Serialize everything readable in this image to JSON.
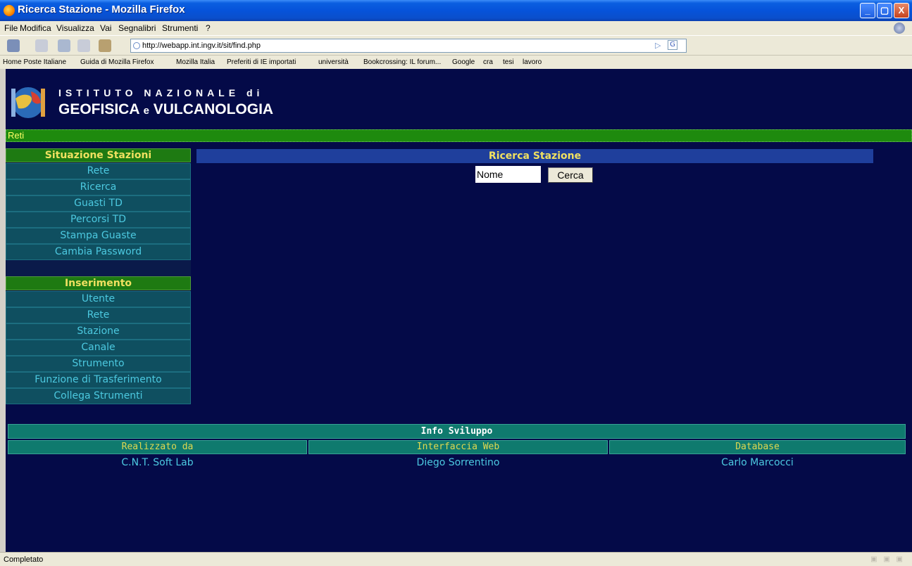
{
  "window": {
    "title": "Ricerca Stazione - Mozilla Firefox",
    "minimize": "_",
    "maximize": "▢",
    "close": "X"
  },
  "menubar": [
    "File",
    "Modifica",
    "Visualizza",
    "Vai",
    "Segnalibri",
    "Strumenti",
    "?"
  ],
  "navbar": {
    "url": "http://webapp.int.ingv.it/sit/find.php",
    "go_label": "▷",
    "search_engine_label": "G"
  },
  "bookmarks": [
    "Home Poste Italiane",
    "Guida di Mozilla Firefox",
    "Mozilla Italia",
    "Preferiti di IE importati",
    "università",
    "Bookcrossing: IL forum...",
    "Google",
    "cra",
    "tesi",
    "lavoro"
  ],
  "logo": {
    "line1": "ISTITUTO NAZIONALE di",
    "line2_a": "GEOFISICA ",
    "line2_e": "e",
    "line2_b": " VULCANOLOGIA"
  },
  "section_bar": "Reti",
  "menu": {
    "situazione": {
      "header": "Situazione Stazioni",
      "items": [
        "Rete",
        "Ricerca",
        "Guasti TD",
        "Percorsi TD",
        "Stampa Guaste",
        "Cambia Password"
      ]
    },
    "inserimento": {
      "header": "Inserimento",
      "items": [
        "Utente",
        "Rete",
        "Stazione",
        "Canale",
        "Strumento",
        "Funzione di Trasferimento",
        "Collega Strumenti"
      ]
    }
  },
  "search": {
    "title": "Ricerca Stazione",
    "input_value": "Nome",
    "button_label": "Cerca"
  },
  "info": {
    "title": "Info Sviluppo",
    "columns": [
      {
        "header": "Realizzato da",
        "value": "C.N.T. Soft Lab"
      },
      {
        "header": "Interfaccia Web",
        "value": "Diego Sorrentino"
      },
      {
        "header": "Database",
        "value": "Carlo Marcocci"
      }
    ]
  },
  "status": {
    "text": "Completato"
  },
  "colors": {
    "page_background": "#040a48",
    "menu_header": "#1e7a12",
    "menu_item": "#0f4f60",
    "menu_text": "#4cc9e0",
    "title_yellow": "#f0e060",
    "info_teal": "#0f7a6e"
  }
}
